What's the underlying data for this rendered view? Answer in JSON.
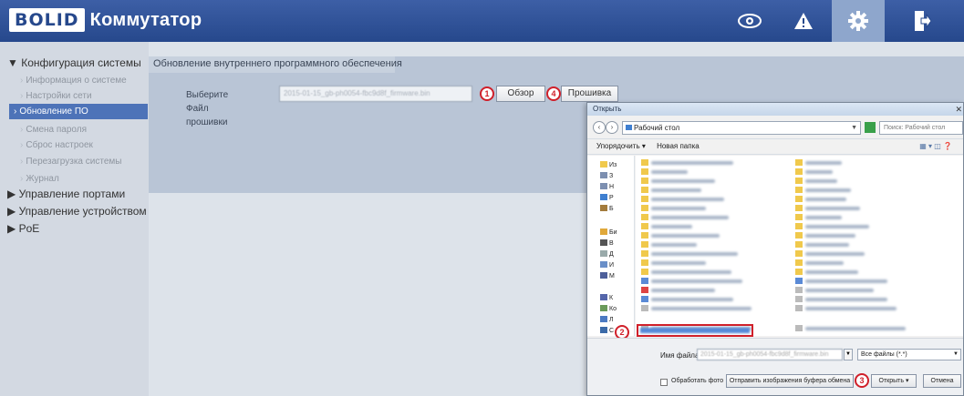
{
  "header": {
    "logo": "BOLID",
    "title": "Коммутатор",
    "icons": [
      "eye-icon",
      "alert-icon",
      "gear-icon",
      "logout-icon"
    ]
  },
  "sidebar": {
    "groups": [
      {
        "label": "▼ Конфигурация системы"
      },
      {
        "label": "▶ Управление портами"
      },
      {
        "label": "▶ Управление устройством"
      },
      {
        "label": "▶ PoE"
      }
    ],
    "items": [
      {
        "label": "Информация о системе"
      },
      {
        "label": "Настройки сети"
      },
      {
        "label": "Обновление ПО"
      },
      {
        "label": "Смена пароля"
      },
      {
        "label": "Сброс настроек"
      },
      {
        "label": "Перезагрузка системы"
      },
      {
        "label": "Журнал"
      }
    ]
  },
  "main": {
    "title": "Обновление внутреннего программного обеспечения",
    "file_label": "Выберите Файл прошивки",
    "browse_button": "Обзор",
    "flash_button": "Прошивка",
    "markers": [
      "1",
      "2",
      "3",
      "4"
    ]
  },
  "dialog": {
    "title": "Открыть",
    "address": "Рабочий стол",
    "search_placeholder": "Поиск: Рабочий стол",
    "toolbar": {
      "organize": "Упорядочить ▾",
      "new_folder": "Новая папка"
    },
    "tree": [
      "Из",
      "З",
      "Н",
      "Р",
      "Б",
      "Би",
      "В",
      "Д",
      "И",
      "М",
      "К",
      "Ко",
      "Л",
      "С"
    ],
    "file_name_label": "Имя файла:",
    "filter": "Все файлы (*.*)",
    "process_label": "Обработать фото",
    "clipboard_button": "Отправить изображения буфера обмена",
    "open_button": "Открыть",
    "cancel_button": "Отмена"
  },
  "colors": {
    "header": "#26488c",
    "active_item": "#4d73b8",
    "marker": "#d0202a"
  }
}
